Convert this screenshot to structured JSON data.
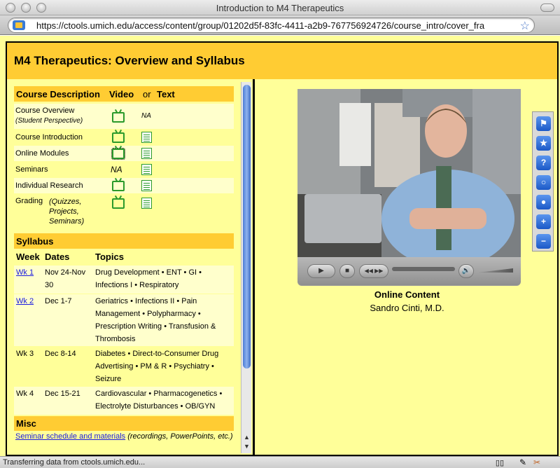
{
  "window": {
    "title": "Introduction to M4 Therapeutics"
  },
  "address": {
    "url": "https://ctools.umich.edu/access/content/group/01202d5f-83fc-4411-a2b9-767756924726/course_intro/cover_fra"
  },
  "header": {
    "title": "M4 Therapeutics: Overview and Syllabus"
  },
  "course_desc": {
    "heading_1": "Course Description",
    "heading_video": "Video",
    "heading_or": "or",
    "heading_text": "Text",
    "rows": [
      {
        "label": "Course Overview",
        "sub": "(Student Perspective)",
        "text": "NA"
      },
      {
        "label": "Course Introduction"
      },
      {
        "label": "Online Modules"
      },
      {
        "label": "Seminars",
        "video": "NA"
      },
      {
        "label": "Individual Research"
      },
      {
        "label": "Grading",
        "sub": "(Quizzes, Projects, Seminars)"
      }
    ]
  },
  "syllabus": {
    "heading": "Syllabus",
    "col_week": "Week",
    "col_dates": "Dates",
    "col_topics": "Topics",
    "rows": [
      {
        "week": "Wk 1",
        "dates": "Nov 24-Nov 30",
        "topics": "Drug Development • ENT • GI • Infections I • Respiratory"
      },
      {
        "week": "Wk 2",
        "dates": "Dec 1-7",
        "topics": "Geriatrics • Infections II • Pain Management • Polypharmacy • Prescription Writing • Transfusion & Thrombosis"
      },
      {
        "week": "Wk 3",
        "dates": "Dec 8-14",
        "topics": "Diabetes • Direct-to-Consumer Drug Advertising • PM & R • Psychiatry • Seizure"
      },
      {
        "week": "Wk 4",
        "dates": "Dec 15-21",
        "topics": "Cardiovascular • Pharmacogenetics • Electrolyte Disturbances • OB/GYN"
      }
    ]
  },
  "misc": {
    "heading": "Misc",
    "link": "Seminar schedule and materials",
    "note": "(recordings, PowerPoints, etc.)"
  },
  "video": {
    "caption_title": "Online Content",
    "caption_sub": "Sandro Cinti, M.D."
  },
  "status": {
    "text": "Transferring data from ctools.umich.edu..."
  }
}
